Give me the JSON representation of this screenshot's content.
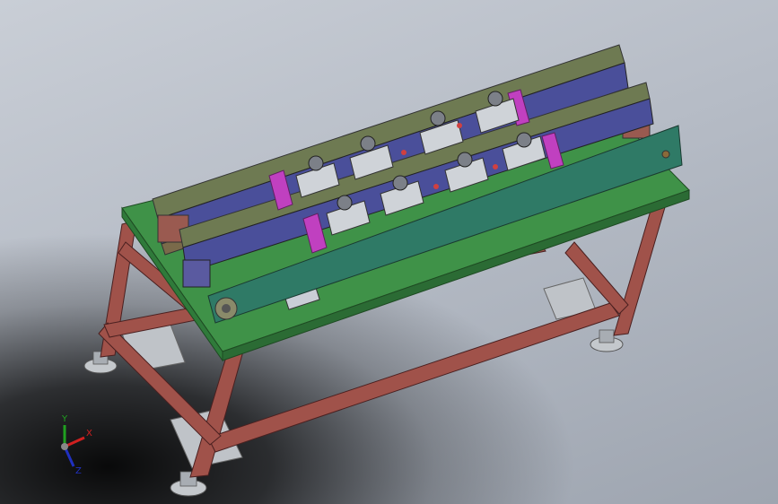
{
  "viewport": {
    "background_top": "#c9ced6",
    "background_bottom": "#9ea5b0",
    "shadow_color": "#000000"
  },
  "model": {
    "frame_color": "#a0524a",
    "top_plate_color": "#3a8a4a",
    "side_panel_color": "#2f7a66",
    "rail_color": "#4a4f9a",
    "bracket_color": "#c040c0",
    "block_color": "#c8ccd0",
    "foot_color": "#b9bec4"
  },
  "triad": {
    "x_label": "X",
    "y_label": "Y",
    "z_label": "Z",
    "x_color": "#d02020",
    "y_color": "#20a020",
    "z_color": "#2030c0"
  }
}
